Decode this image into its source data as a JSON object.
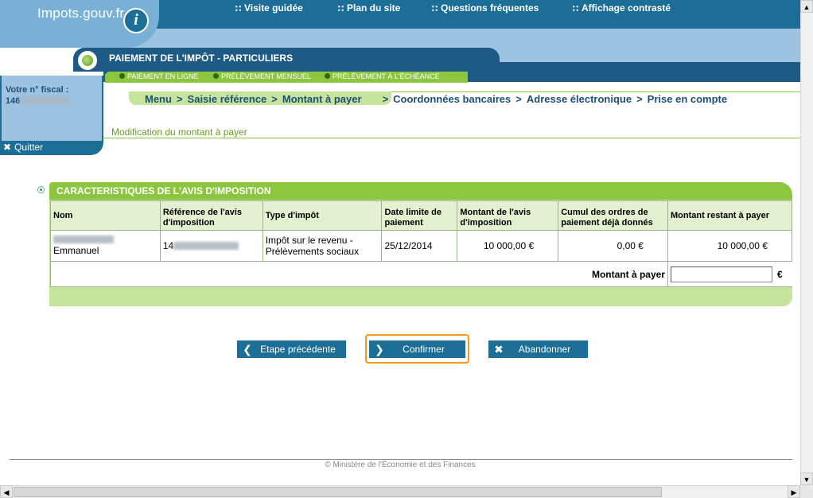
{
  "header": {
    "logo": "Impots.gouv.fr",
    "logo_icon": "i",
    "links": [
      "Visite guidée",
      "Plan du site",
      "Questions fréquentes",
      "Affichage contrasté"
    ]
  },
  "section": {
    "title": "PAIEMENT DE L'IMPÔT - PARTICULIERS",
    "subnav": [
      "PAIEMENT EN LIGNE",
      "PRÉLÈVEMENT MENSUEL",
      "PRÉLÈVEMENT À L'ÉCHÉANCE"
    ]
  },
  "sidebar": {
    "fiscal_label": "Votre n° fiscal :",
    "fiscal_prefix": "146",
    "quit_label": "Quitter"
  },
  "breadcrumb": {
    "done": [
      "Menu",
      "Saisie référence",
      "Montant à payer"
    ],
    "todo": [
      "Coordonnées bancaires",
      "Adresse électronique",
      "Prise en compte"
    ],
    "sep": ">"
  },
  "page": {
    "subtitle": "Modification du montant à payer"
  },
  "avis": {
    "title": "CARACTERISTIQUES DE L'AVIS D'IMPOSITION",
    "columns": [
      "Nom",
      "Référence de l'avis d'imposition",
      "Type d'impôt",
      "Date limite de paiement",
      "Montant de l'avis d'imposition",
      "Cumul des ordres de paiement déjà donnés",
      "Montant restant à payer"
    ],
    "row": {
      "nom": "Emmanuel",
      "reference_prefix": "14",
      "type": "Impôt sur le revenu - Prélèvements sociaux",
      "date_limite": "25/12/2014",
      "montant_avis": "10 000,00 €",
      "cumul": "0,00 €",
      "restant": "10 000,00 €"
    },
    "montant_label": "Montant à payer",
    "montant_value": "",
    "currency": "€"
  },
  "buttons": {
    "prev": "Etape précédente",
    "confirm": "Confirmer",
    "cancel": "Abandonner"
  },
  "footer": {
    "text": "© Ministère de l'Économie et des Finances"
  },
  "colors": {
    "brand_blue": "#1d6e96",
    "brand_green": "#8cc63f",
    "focus_orange": "#f39a1c"
  }
}
